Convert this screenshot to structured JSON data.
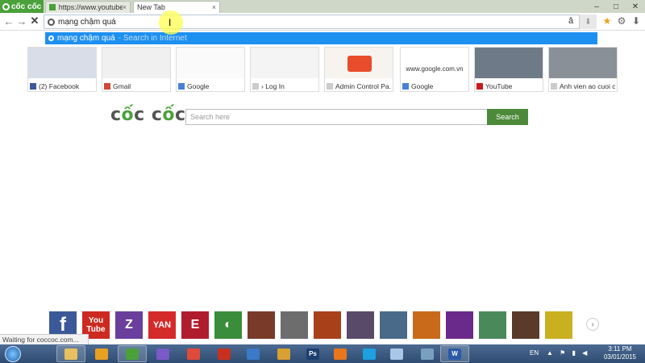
{
  "browser": {
    "brand_tab": "cốc cốc",
    "tabs": [
      {
        "label": "https://www.youtube.com",
        "close": "×"
      },
      {
        "label": "New Tab",
        "close": "×"
      }
    ],
    "window_buttons": [
      "–",
      "□",
      "✕"
    ]
  },
  "toolbar": {
    "back": "←",
    "forward": "→",
    "stop": "✕",
    "omnibox_value": "mạng chậm quá",
    "download_label": "⬇",
    "star": "★",
    "gear": "⚙",
    "download": "⬇"
  },
  "suggestion": {
    "query": "mạng chậm quá",
    "hint": "- Search in Internet"
  },
  "thumbnails": [
    {
      "caption": "(2) Facebook",
      "icon": "facebook-icon",
      "icon_color": "#3b5998"
    },
    {
      "caption": "Gmail",
      "icon": "gmail-icon",
      "icon_color": "#d14836"
    },
    {
      "caption": "Google",
      "icon": "google-icon",
      "icon_color": "#4a7fd8"
    },
    {
      "caption": "› Log In",
      "icon": "page-icon",
      "icon_color": "#cccccc"
    },
    {
      "caption": "Admin Control Pa...",
      "icon": "page-icon",
      "icon_color": "#cccccc"
    },
    {
      "caption": "Google",
      "icon": "google-icon",
      "icon_color": "#4a7fd8"
    },
    {
      "caption": "YouTube",
      "icon": "youtube-icon",
      "icon_color": "#cc181e"
    },
    {
      "caption": "Anh vien ao cuoi ch...",
      "icon": "page-icon",
      "icon_color": "#cccccc"
    }
  ],
  "thumb_texts": {
    "google_url": "www.google.com.vn"
  },
  "brand": {
    "part1": "c",
    "o1": "ố",
    "part2": "c c",
    "o2": "ố",
    "part3": "c"
  },
  "search": {
    "placeholder": "Search here",
    "button": "Search"
  },
  "apps": [
    {
      "name": "facebook",
      "label": "f",
      "color": "#3b5998"
    },
    {
      "name": "youtube",
      "label": "You Tube",
      "color": "#cc2a20"
    },
    {
      "name": "zing",
      "label": "Z",
      "color": "#6a3e9c"
    },
    {
      "name": "yan",
      "label": "YAN",
      "color": "#d42a2a"
    },
    {
      "name": "e-app",
      "label": "E",
      "color": "#b01c2e"
    },
    {
      "name": "game-green",
      "label": "◐",
      "color": "#3a8d3a"
    },
    {
      "name": "game-warrior",
      "label": "",
      "color": "#7a3a2a"
    },
    {
      "name": "game-dragon",
      "label": "",
      "color": "#6d6d6d"
    },
    {
      "name": "game-swirl",
      "label": "",
      "color": "#a8401a"
    },
    {
      "name": "game-girl",
      "label": "",
      "color": "#5a4a6a"
    },
    {
      "name": "game-plane",
      "label": "",
      "color": "#4a6a8a"
    },
    {
      "name": "game-fire",
      "label": "",
      "color": "#c86a1a"
    },
    {
      "name": "game-purple",
      "label": "",
      "color": "#6a2a8a"
    },
    {
      "name": "game-blade",
      "label": "",
      "color": "#4a8a5a"
    },
    {
      "name": "game-hero",
      "label": "",
      "color": "#5a3a2a"
    },
    {
      "name": "game-yellow",
      "label": "",
      "color": "#c8b020"
    }
  ],
  "dock_next": "›",
  "status_text": "Waiting for coccoc.com...",
  "taskbar": {
    "apps": [
      {
        "name": "explorer",
        "color": "#e8c060"
      },
      {
        "name": "media-player",
        "color": "#e8a020"
      },
      {
        "name": "coccoc",
        "color": "#4aa13a"
      },
      {
        "name": "visual-studio",
        "color": "#7a5ac8"
      },
      {
        "name": "chrome",
        "color": "#e04a3a"
      },
      {
        "name": "filezilla",
        "color": "#c83020"
      },
      {
        "name": "network",
        "color": "#3a7ac8"
      },
      {
        "name": "paint",
        "color": "#d8a030"
      },
      {
        "name": "photoshop",
        "color": "#1c3f6e"
      },
      {
        "name": "firefox",
        "color": "#e8761c"
      },
      {
        "name": "skype",
        "color": "#1ca0e0"
      },
      {
        "name": "notepad",
        "color": "#a8c8e8"
      },
      {
        "name": "tool",
        "color": "#7aa0c0"
      },
      {
        "name": "word",
        "color": "#2a5aa8"
      }
    ],
    "ps_label": "Ps",
    "word_label": "W",
    "lang": "EN",
    "tray": "▲ ⚑ ▮ ◀",
    "time": "3:11 PM",
    "date": "03/01/2015"
  }
}
